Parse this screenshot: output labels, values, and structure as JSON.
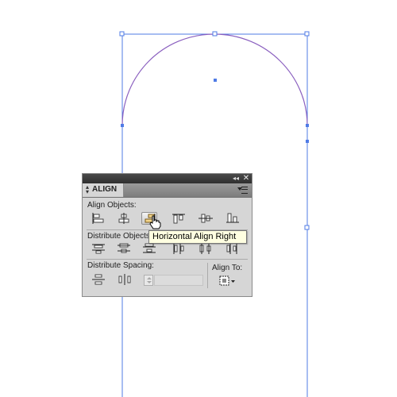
{
  "canvas": {
    "path_color": "#8a5fbf",
    "guide_color": "#4f7be6",
    "handle_color": "#4f7be6"
  },
  "panel": {
    "title": "ALIGN",
    "collapse_glyph": "◂◂",
    "close_glyph": "✕",
    "align_objects_label": "Align Objects:",
    "distribute_objects_label": "Distribute Objects:",
    "distribute_spacing_label": "Distribute Spacing:",
    "align_to_label": "Align To:",
    "spacing_value": "",
    "align_buttons": [
      {
        "icon": "horizontal-align-left-icon",
        "active": false
      },
      {
        "icon": "horizontal-align-center-icon",
        "active": false
      },
      {
        "icon": "horizontal-align-right-icon",
        "active": true
      },
      {
        "icon": "vertical-align-top-icon",
        "active": false
      },
      {
        "icon": "vertical-align-center-icon",
        "active": false
      },
      {
        "icon": "vertical-align-bottom-icon",
        "active": false
      }
    ],
    "distribute_buttons": [
      {
        "icon": "vertical-distribute-top-icon"
      },
      {
        "icon": "vertical-distribute-center-icon"
      },
      {
        "icon": "vertical-distribute-bottom-icon"
      },
      {
        "icon": "horizontal-distribute-left-icon"
      },
      {
        "icon": "horizontal-distribute-center-icon"
      },
      {
        "icon": "horizontal-distribute-right-icon"
      }
    ],
    "spacing_buttons": [
      {
        "icon": "vertical-distribute-space-icon"
      },
      {
        "icon": "horizontal-distribute-space-icon"
      }
    ],
    "align_to_icon": "align-to-selection-icon"
  },
  "tooltip": {
    "text": "Horizontal Align Right"
  }
}
